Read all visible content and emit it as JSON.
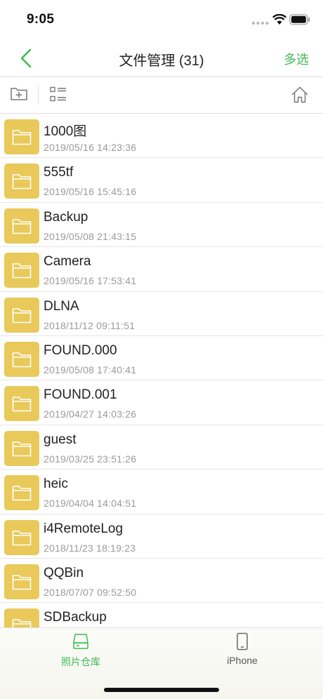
{
  "status_bar": {
    "time": "9:05"
  },
  "nav": {
    "title": "文件管理 (31)",
    "multi_select": "多选"
  },
  "toolbar": {
    "icons": [
      "new-folder-icon",
      "list-view-icon",
      "home-icon"
    ]
  },
  "files": [
    {
      "name": "1000图",
      "date": "2019/05/16 14:23:36"
    },
    {
      "name": "555tf",
      "date": "2019/05/16 15:45:16"
    },
    {
      "name": "Backup",
      "date": "2019/05/08 21:43:15"
    },
    {
      "name": "Camera",
      "date": "2019/05/16 17:53:41"
    },
    {
      "name": "DLNA",
      "date": "2018/11/12 09:11:51"
    },
    {
      "name": "FOUND.000",
      "date": "2019/05/08 17:40:41"
    },
    {
      "name": "FOUND.001",
      "date": "2019/04/27 14:03:26"
    },
    {
      "name": "guest",
      "date": "2019/03/25 23:51:26"
    },
    {
      "name": "heic",
      "date": "2019/04/04 14:04:51"
    },
    {
      "name": "i4RemoteLog",
      "date": "2018/11/23 18:19:23"
    },
    {
      "name": "QQBin",
      "date": "2018/07/07 09:52:50"
    },
    {
      "name": "SDBackup",
      "date": ""
    }
  ],
  "tabs": [
    {
      "label": "照片仓库",
      "icon": "drive-icon",
      "active": true
    },
    {
      "label": "iPhone",
      "icon": "phone-icon",
      "active": false
    }
  ],
  "colors": {
    "accent": "#3fba54",
    "folder": "#e8c95a"
  }
}
